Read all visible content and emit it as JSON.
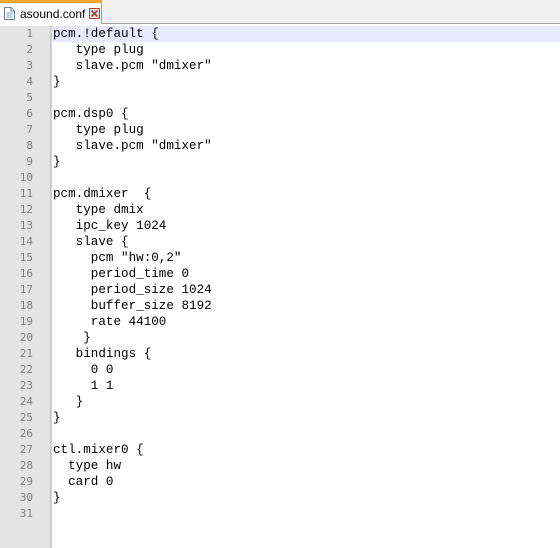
{
  "tab": {
    "filename": "asound.conf",
    "file_icon": "file-icon",
    "close_icon": "close-icon",
    "close_color": "#c0392b",
    "accent": "#f5a623"
  },
  "editor": {
    "current_line": 1,
    "lines": [
      {
        "n": "1",
        "text": "pcm.!default {"
      },
      {
        "n": "2",
        "text": "   type plug"
      },
      {
        "n": "3",
        "text": "   slave.pcm \"dmixer\""
      },
      {
        "n": "4",
        "text": "}"
      },
      {
        "n": "5",
        "text": ""
      },
      {
        "n": "6",
        "text": "pcm.dsp0 {"
      },
      {
        "n": "7",
        "text": "   type plug"
      },
      {
        "n": "8",
        "text": "   slave.pcm \"dmixer\""
      },
      {
        "n": "9",
        "text": "}"
      },
      {
        "n": "10",
        "text": ""
      },
      {
        "n": "11",
        "text": "pcm.dmixer  {"
      },
      {
        "n": "12",
        "text": "   type dmix"
      },
      {
        "n": "13",
        "text": "   ipc_key 1024"
      },
      {
        "n": "14",
        "text": "   slave {"
      },
      {
        "n": "15",
        "text": "     pcm \"hw:0,2\""
      },
      {
        "n": "16",
        "text": "     period_time 0"
      },
      {
        "n": "17",
        "text": "     period_size 1024"
      },
      {
        "n": "18",
        "text": "     buffer_size 8192"
      },
      {
        "n": "19",
        "text": "     rate 44100"
      },
      {
        "n": "20",
        "text": "    }"
      },
      {
        "n": "21",
        "text": "   bindings {"
      },
      {
        "n": "22",
        "text": "     0 0"
      },
      {
        "n": "23",
        "text": "     1 1"
      },
      {
        "n": "24",
        "text": "   }"
      },
      {
        "n": "25",
        "text": "}"
      },
      {
        "n": "26",
        "text": ""
      },
      {
        "n": "27",
        "text": "ctl.mixer0 {"
      },
      {
        "n": "28",
        "text": "  type hw"
      },
      {
        "n": "29",
        "text": "  card 0"
      },
      {
        "n": "30",
        "text": "}"
      },
      {
        "n": "31",
        "text": ""
      }
    ]
  }
}
